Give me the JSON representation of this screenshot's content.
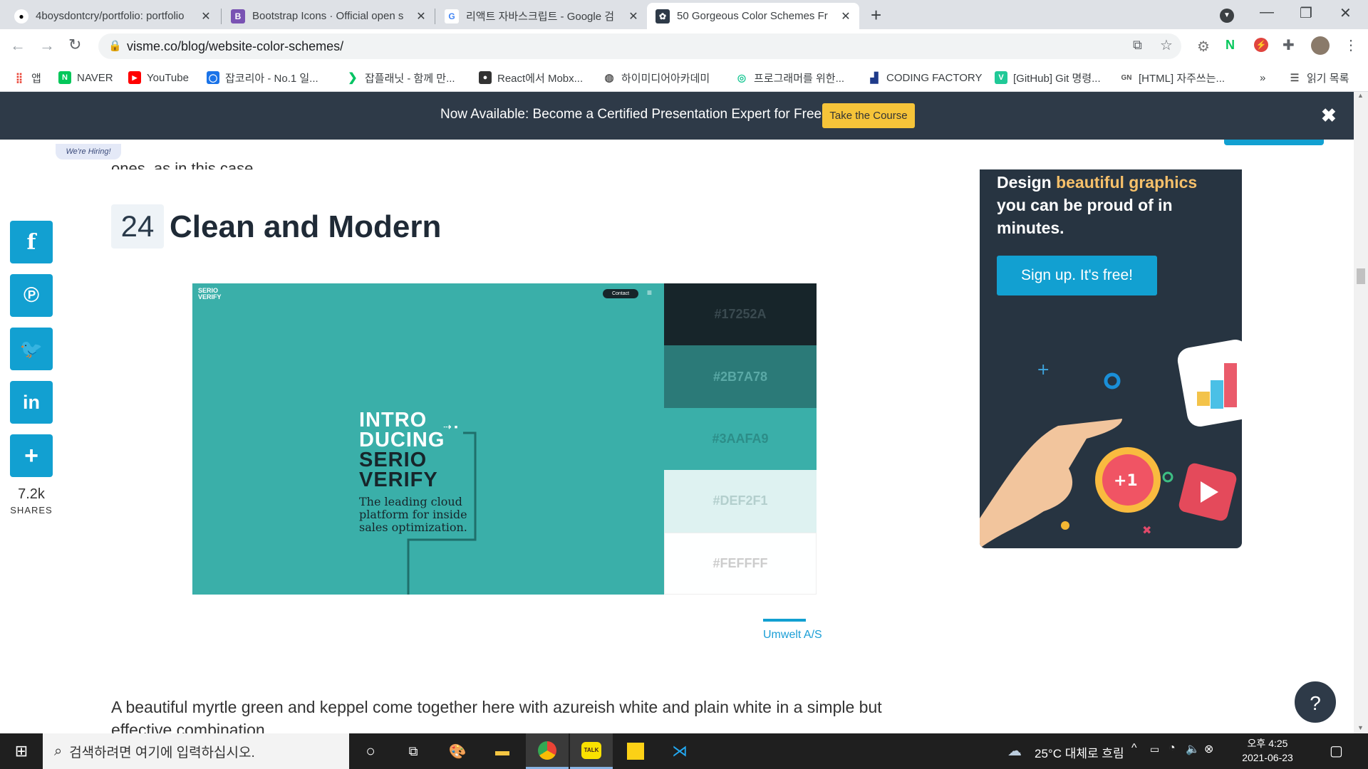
{
  "browser": {
    "tabs": [
      {
        "title": "4boysdontcry/portfolio: portfolio",
        "favicon": "github-icon"
      },
      {
        "title": "Bootstrap Icons · Official open s",
        "favicon": "bootstrap-icon"
      },
      {
        "title": "리액트 자바스크립트 - Google 검",
        "favicon": "google-icon"
      },
      {
        "title": "50 Gorgeous Color Schemes Fr",
        "favicon": "visme-icon",
        "active": true
      }
    ],
    "url": "visme.co/blog/website-color-schemes/",
    "bookmarks": [
      {
        "label": "앱",
        "icon": "apps-icon"
      },
      {
        "label": "NAVER",
        "icon": "naver-icon"
      },
      {
        "label": "YouTube",
        "icon": "youtube-icon"
      },
      {
        "label": "잡코리아 - No.1 일...",
        "icon": "jobkorea-icon"
      },
      {
        "label": "잡플래닛 - 함께 만...",
        "icon": "jobplanet-icon"
      },
      {
        "label": "React에서 Mobx...",
        "icon": "blog-icon"
      },
      {
        "label": "하이미디어아카데미",
        "icon": "globe-icon"
      },
      {
        "label": "프로그래머를 위한...",
        "icon": "programmers-icon"
      },
      {
        "label": "CODING FACTORY",
        "icon": "codingfactory-icon"
      },
      {
        "label": "[GitHub] Git 명령...",
        "icon": "velog-icon"
      },
      {
        "label": "[HTML] 자주쓰는...",
        "icon": "gn-icon"
      },
      {
        "label": "»",
        "icon": ""
      },
      {
        "label": "읽기 목록",
        "icon": "reading-list-icon"
      }
    ]
  },
  "banner": {
    "text": "Now Available: Become a Certified Presentation Expert for Free",
    "button": "Take the Course",
    "close": "✖"
  },
  "hiring": "We're Hiring!",
  "article": {
    "prev_text": "ones, as in this case.",
    "section_number": "24",
    "section_title": "Clean and Modern",
    "hero": {
      "brand": "SERIO VERIFY",
      "contact": "Contact",
      "headline_1": "INTRO",
      "headline_2": "DUCING",
      "headline_3": "SERIO",
      "headline_4": "VERIFY",
      "sub_1": "The leading cloud",
      "sub_2": "platform for inside",
      "sub_3": "sales optimization.",
      "bg": "#3AAFA9"
    },
    "swatches": [
      {
        "hex": "#17252A",
        "fg": "#3a4a50"
      },
      {
        "hex": "#2B7A78",
        "fg": "#5aa9a6"
      },
      {
        "hex": "#3AAFA9",
        "fg": "#2c8d88"
      },
      {
        "hex": "#DEF2F1",
        "fg": "#b3cfcd"
      },
      {
        "hex": "#FEFFFF",
        "fg": "#cccccc"
      }
    ],
    "caption": "Umwelt A/S",
    "body": "A beautiful myrtle green and keppel come together here with azureish white and plain white in a simple but effective combination."
  },
  "share": {
    "buttons": [
      "facebook-icon",
      "pinterest-icon",
      "twitter-icon",
      "linkedin-icon",
      "plus-icon"
    ],
    "count": "7.2k",
    "label": "SHARES"
  },
  "ad": {
    "head_1": "Design ",
    "head_highlight": "beautiful graphics",
    "head_2": " you can be proud of in minutes.",
    "button": "Sign up. It's free!"
  },
  "help": "?",
  "taskbar": {
    "search_placeholder": "검색하려면 여기에 입력하십시오.",
    "weather": "25°C  대체로 흐림",
    "time": "오후 4:25",
    "date": "2021-06-23"
  }
}
